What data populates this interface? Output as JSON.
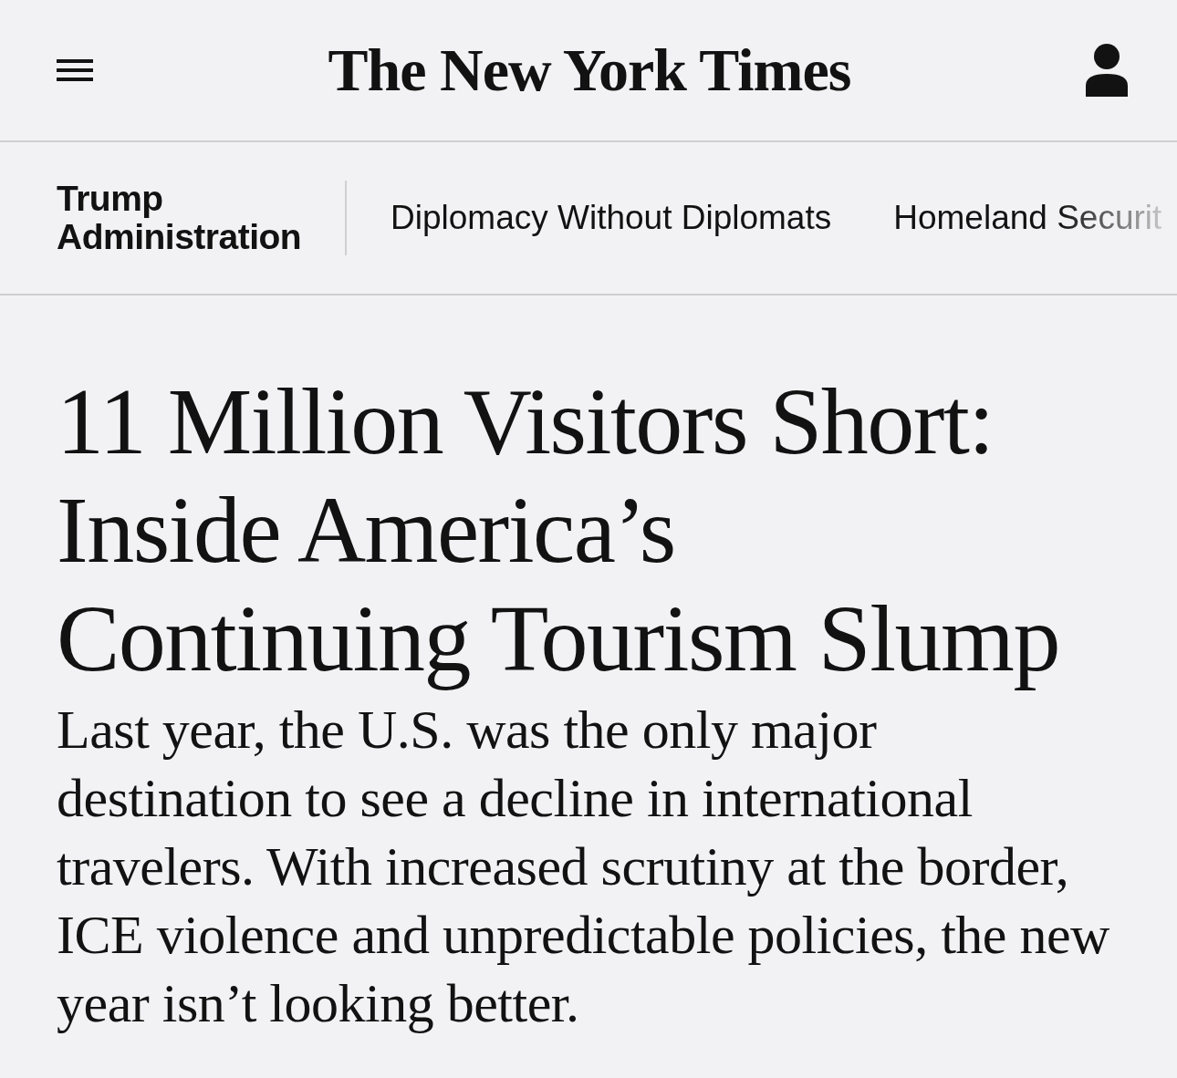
{
  "header": {
    "logo": "The New York Times"
  },
  "section_nav": {
    "section": "Trump Administration",
    "items": [
      "Diplomacy Without Diplomats",
      "Homeland Securit"
    ]
  },
  "article": {
    "headline": "11 Million Visitors Short: Inside America’s Continuing Tourism Slump",
    "summary": "Last year, the U.S. was the only major destination to see a decline in international travelers. With increased scrutiny at the border, ICE violence and unpredictable policies, the new year isn’t looking better."
  }
}
